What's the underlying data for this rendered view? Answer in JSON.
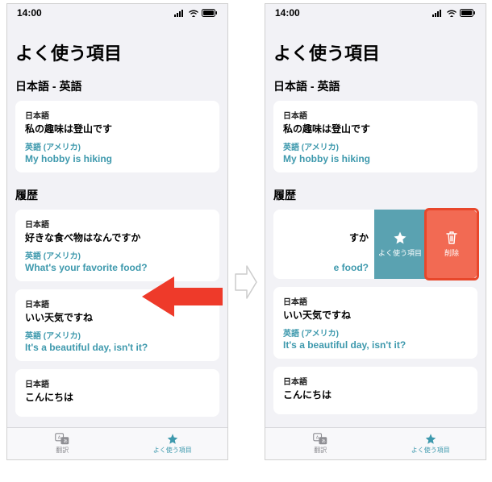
{
  "status": {
    "time": "14:00"
  },
  "title": "よく使う項目",
  "lang_pair": "日本語 - 英語",
  "labels": {
    "src": "日本語",
    "trg": "英語 (アメリカ)",
    "history": "履歴"
  },
  "fav": {
    "src": "私の趣味は登山です",
    "trg": "My hobby is hiking"
  },
  "history": [
    {
      "src": "好きな食べ物はなんですか",
      "trg": "What's your favorite food?"
    },
    {
      "src": "いい天気ですね",
      "trg": "It's a beautiful day, isn't it?"
    },
    {
      "src": "こんにちは",
      "trg": ""
    }
  ],
  "swiped": {
    "src_tail": "すか",
    "trg_tail": "e food?"
  },
  "actions": {
    "fav": "よく使う項目",
    "del": "削除"
  },
  "tabs": {
    "translate": "翻訳",
    "favorites": "よく使う項目"
  }
}
